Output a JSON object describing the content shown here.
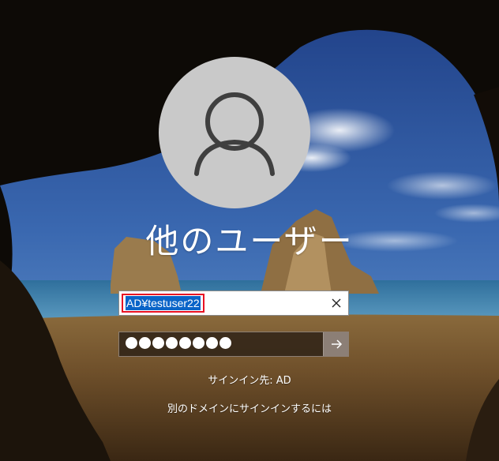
{
  "user": {
    "display_name": "他のユーザー",
    "avatar_icon": "user-silhouette-icon"
  },
  "login": {
    "username_value": "AD¥testuser22",
    "clear_icon": "close-icon",
    "password_mask": "●●●●●●●●",
    "password_length": 8,
    "submit_icon": "arrow-right-icon",
    "signin_to": "サインイン先: AD",
    "other_domain_link": "別のドメインにサインインするには"
  },
  "colors": {
    "selection": "#0a64c8",
    "highlight_border": "#e81123",
    "avatar_bg": "#c9c9c9"
  }
}
